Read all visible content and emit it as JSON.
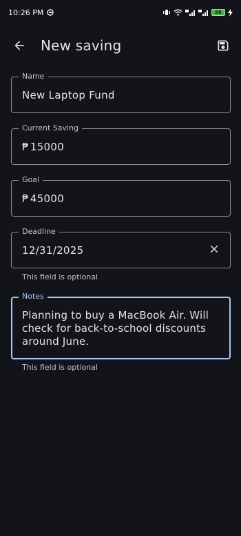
{
  "status_bar": {
    "time": "10:26 PM",
    "battery": "96"
  },
  "app_bar": {
    "title": "New saving",
    "back_icon": "arrow-back-icon",
    "save_icon": "save-icon"
  },
  "form": {
    "name": {
      "label": "Name",
      "value": "New Laptop Fund"
    },
    "current_saving": {
      "label": "Current Saving",
      "currency": "₱",
      "value": "15000"
    },
    "goal": {
      "label": "Goal",
      "currency": "₱",
      "value": "45000"
    },
    "deadline": {
      "label": "Deadline",
      "value": "12/31/2025",
      "helper": "This field is optional"
    },
    "notes": {
      "label": "Notes",
      "value": "Planning to buy a MacBook Air. Will check for back-to-school discounts around June.",
      "helper": "This field is optional"
    }
  },
  "colors": {
    "background": "#131419",
    "outline": "#8e9099",
    "focus": "#aac7ff",
    "battery": "#4caf50"
  }
}
